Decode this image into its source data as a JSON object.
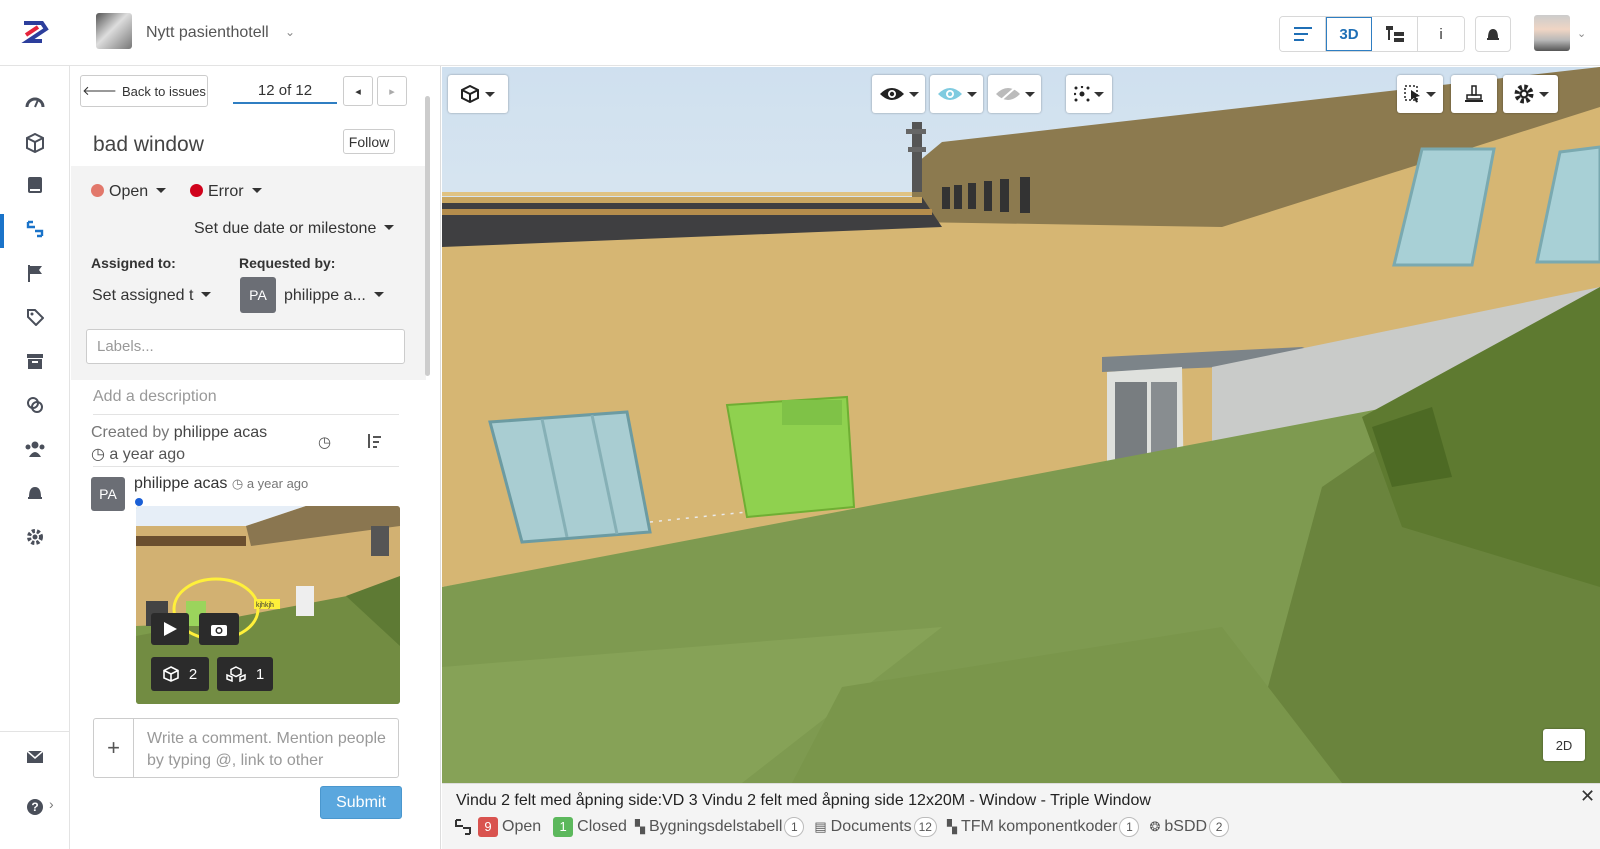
{
  "header": {
    "project_name": "Nytt pasienthotell",
    "view_3d": "3D",
    "view_info": "i"
  },
  "colors": {
    "accent": "#2f7ec2",
    "status_open": "#e2786b",
    "priority_error": "#d0021b",
    "submit": "#5aa7de",
    "open_badge": "#d9534f",
    "closed_badge": "#5cb85c",
    "selection_green": "#8fd14f"
  },
  "sidebar": {
    "items": [
      "dashboard-icon",
      "model-icon",
      "library-icon",
      "issues-icon",
      "flag-icon",
      "tags-icon",
      "archive-icon",
      "links-icon",
      "team-icon",
      "bell-icon",
      "settings-icon"
    ],
    "bottom": [
      "mail-icon",
      "help-icon"
    ],
    "expand": "›"
  },
  "issue": {
    "back_label": "Back to issues",
    "counter": "12 of 12",
    "prev": "◂",
    "next": "▸",
    "title": "bad window",
    "follow_label": "Follow",
    "status": "Open",
    "priority": "Error",
    "due_label": "Set due date or milestone",
    "assigned_label": "Assigned to:",
    "assigned_value": "Set assigned t",
    "requested_label": "Requested by:",
    "requester_initials": "PA",
    "requester_name": "philippe a...",
    "labels_placeholder": "Labels...",
    "description_placeholder": "Add a description",
    "created_prefix": "Created by",
    "created_by": "philippe acas",
    "created_time": "a year ago",
    "comment_author": "philippe acas",
    "comment_time": "a year ago",
    "comment_initials": "PA",
    "thumb_models": "2",
    "thumb_objects": "1",
    "thumb_note": "kjhkjh",
    "comment_placeholder": "Write a comment. Mention people by typing @, link to other",
    "add_label": "+",
    "submit_label": "Submit"
  },
  "viewer": {
    "label_2d": "2D"
  },
  "info": {
    "title": "Vindu 2 felt med åpning side:VD 3 Vindu 2 felt med åpning side 12x20M - Window - Triple Window",
    "open_count": "9",
    "open_label": "Open",
    "closed_count": "1",
    "closed_label": "Closed",
    "tabs": [
      {
        "label": "Bygningsdelstabell",
        "count": "1"
      },
      {
        "label": "Documents",
        "count": "12"
      },
      {
        "label": "TFM komponentkoder",
        "count": "1"
      },
      {
        "label": "bSDD",
        "count": "2"
      }
    ],
    "close": "✕"
  }
}
